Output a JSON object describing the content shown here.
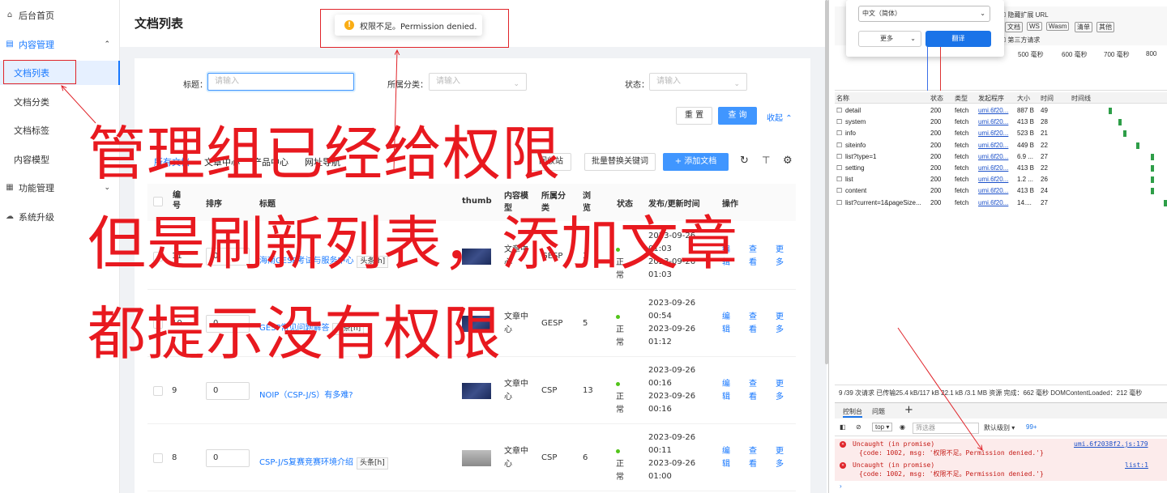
{
  "sidebar": {
    "items": [
      {
        "label": "后台首页",
        "icon": "home-icon"
      },
      {
        "label": "内容管理",
        "icon": "list-icon"
      },
      {
        "label": "文档列表"
      },
      {
        "label": "文档分类"
      },
      {
        "label": "文档标签"
      },
      {
        "label": "内容模型"
      },
      {
        "label": "功能管理",
        "icon": "grid-icon"
      },
      {
        "label": "系统升级",
        "icon": "cloud-icon"
      }
    ]
  },
  "header": {
    "title": "文档列表"
  },
  "toast": {
    "text": "权限不足。Permission denied."
  },
  "filters": {
    "title_label": "标题：",
    "title_placeholder": "请输入",
    "category_label": "所属分类：",
    "category_placeholder": "请输入",
    "status_label": "状态：",
    "status_placeholder": "请输入",
    "reset": "重 置",
    "search": "查 询",
    "collapse": "收起"
  },
  "tabs": [
    "所有文档",
    "文章中心",
    "产品中心",
    "网址导航"
  ],
  "toolbar": {
    "replace": "批量替换关键词",
    "recycle": "回收站",
    "add": "+ 添加文档"
  },
  "table": {
    "headers": [
      "编号",
      "排序",
      "标题",
      "thumb",
      "内容模型",
      "所属分类",
      "浏览",
      "状态",
      "发布/更新时间",
      "操作"
    ],
    "rows": [
      {
        "id": "11",
        "sort": "0",
        "title": "海南GESP考试与服务中心",
        "tag": "头条[h]",
        "model": "文章中心",
        "category": "GESP",
        "views": "3",
        "status": "正常",
        "time": "2023-09-26 01:03",
        "time2": "2023-09-26 01:03"
      },
      {
        "id": "10",
        "sort": "0",
        "title": "GESP常见问题解答",
        "tag": "头条[h]",
        "model": "文章中心",
        "category": "GESP",
        "views": "5",
        "status": "正常",
        "time": "2023-09-26 00:54",
        "time2": "2023-09-26 01:12"
      },
      {
        "id": "9",
        "sort": "0",
        "title": "NOIP（CSP-J/S）有多难?",
        "tag": "",
        "model": "文章中心",
        "category": "CSP",
        "views": "13",
        "status": "正常",
        "time": "2023-09-26 00:16",
        "time2": "2023-09-26 00:16"
      },
      {
        "id": "8",
        "sort": "0",
        "title": "CSP-J/S复赛竞赛环境介绍",
        "tag": "头条[h]",
        "model": "文章中心",
        "category": "CSP",
        "views": "6",
        "status": "正常",
        "time": "2023-09-26 00:11",
        "time2": "2023-09-26 01:00"
      }
    ],
    "ops": [
      "编辑",
      "查看",
      "更多"
    ]
  },
  "annotation": {
    "line1": "管理组已经给权限",
    "line2": "但是刷新列表，添加文章",
    "line3": "都提示没有权限"
  },
  "devtools": {
    "translate": {
      "lang": "中文（简体）",
      "more": "更多",
      "translate": "翻译"
    },
    "filters": [
      "文档",
      "WS",
      "Wasm",
      "清单",
      "其他"
    ],
    "hide_ext": "隐藏扩展 URL",
    "third_party": "第三方请求",
    "timeline": [
      "500 毫秒",
      "600 毫秒",
      "700 毫秒",
      "800"
    ],
    "columns": [
      "名称",
      "状态",
      "类型",
      "发起程序",
      "大小",
      "时间",
      "时间线"
    ],
    "requests": [
      {
        "name": "detail",
        "status": "200",
        "type": "fetch",
        "init": "umi.6f20...",
        "size": "887 B",
        "time": "49"
      },
      {
        "name": "system",
        "status": "200",
        "type": "fetch",
        "init": "umi.6f20...",
        "size": "413 B",
        "time": "28"
      },
      {
        "name": "info",
        "status": "200",
        "type": "fetch",
        "init": "umi.6f20...",
        "size": "523 B",
        "time": "21"
      },
      {
        "name": "siteinfo",
        "status": "200",
        "type": "fetch",
        "init": "umi.6f20...",
        "size": "449 B",
        "time": "22"
      },
      {
        "name": "list?type=1",
        "status": "200",
        "type": "fetch",
        "init": "umi.6f20...",
        "size": "6.9 ...",
        "time": "27"
      },
      {
        "name": "setting",
        "status": "200",
        "type": "fetch",
        "init": "umi.6f20...",
        "size": "413 B",
        "time": "22"
      },
      {
        "name": "list",
        "status": "200",
        "type": "fetch",
        "init": "umi.6f20...",
        "size": "1.2 ...",
        "time": "26"
      },
      {
        "name": "content",
        "status": "200",
        "type": "fetch",
        "init": "umi.6f20...",
        "size": "413 B",
        "time": "24"
      },
      {
        "name": "list?current=1&pageSize...",
        "status": "200",
        "type": "fetch",
        "init": "umi.6f20...",
        "size": "14....",
        "time": "27"
      }
    ],
    "summary": "9 /39 次请求  已传输25.4 kB/117 kB  22.1 kB /3.1 MB 资源  完成：662 毫秒  DOMContentLoaded：212 毫秒",
    "console_tab": "控制台",
    "issues_tab": "问题",
    "context": "top",
    "filter_placeholder": "筛选器",
    "level": "默认级别",
    "count": "99+",
    "errors": [
      {
        "msg": "Uncaught (in promise)",
        "detail": "{code: 1002, msg: '权限不足。Permission denied.'}",
        "src": "umi.6f2038f2.js:179"
      },
      {
        "msg": "Uncaught (in promise)",
        "detail": "{code: 1002, msg: '权限不足。Permission denied.'}",
        "src": "list:1"
      }
    ]
  }
}
